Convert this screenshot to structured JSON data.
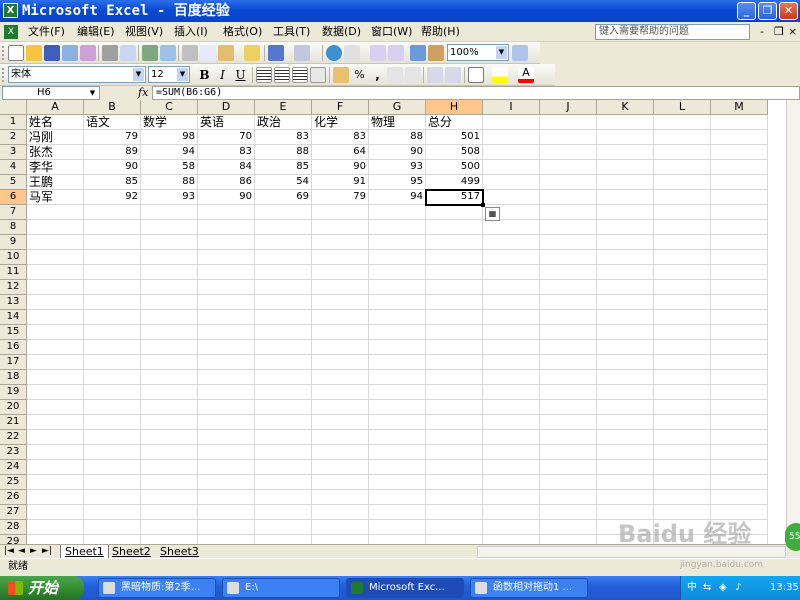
{
  "window": {
    "title": "Microsoft Excel - 百度经验",
    "app_icon": "excel-icon",
    "buttons": [
      "_",
      "❐",
      "✕"
    ]
  },
  "menubar": {
    "items": [
      "文件(F)",
      "编辑(E)",
      "视图(V)",
      "插入(I)",
      "格式(O)",
      "工具(T)",
      "数据(D)",
      "窗口(W)",
      "帮助(H)"
    ],
    "help_placeholder": "键入需要帮助的问题",
    "mdi_buttons": [
      "-",
      "❐",
      "×"
    ]
  },
  "toolbar": {
    "zoom": "100%",
    "font_name": "宋体",
    "font_size": "12",
    "bold": "B",
    "italic": "I",
    "underline": "U",
    "percent": "%",
    "comma": ","
  },
  "formula_bar": {
    "name_box": "H6",
    "fx": "fx",
    "formula": "=SUM(B6:G6)"
  },
  "sheet": {
    "columns": [
      "A",
      "B",
      "C",
      "D",
      "E",
      "F",
      "G",
      "H",
      "I",
      "J",
      "K",
      "L",
      "M"
    ],
    "row_count": 29,
    "selected_cell": "H6",
    "rows": [
      [
        "姓名",
        "语文",
        "数学",
        "英语",
        "政治",
        "化学",
        "物理",
        "总分"
      ],
      [
        "冯刚",
        "79",
        "98",
        "70",
        "83",
        "83",
        "88",
        "501"
      ],
      [
        "张杰",
        "89",
        "94",
        "83",
        "88",
        "64",
        "90",
        "508"
      ],
      [
        "李华",
        "90",
        "58",
        "84",
        "85",
        "90",
        "93",
        "500"
      ],
      [
        "王鹏",
        "85",
        "88",
        "86",
        "54",
        "91",
        "95",
        "499"
      ],
      [
        "马军",
        "92",
        "93",
        "90",
        "69",
        "79",
        "94",
        "517"
      ]
    ]
  },
  "sheet_tabs": [
    "Sheet1",
    "Sheet2",
    "Sheet3"
  ],
  "status": "就绪",
  "taskbar": {
    "start": "开始",
    "tasks": [
      "黑暗物质:第2季...",
      "E:\\",
      "Microsoft Exc...",
      "函数相对拖动1 ..."
    ],
    "clock": "13:35"
  },
  "watermark": {
    "text": "Baidu 经验",
    "url": "jingyan.baidu.com"
  },
  "badge": "55"
}
